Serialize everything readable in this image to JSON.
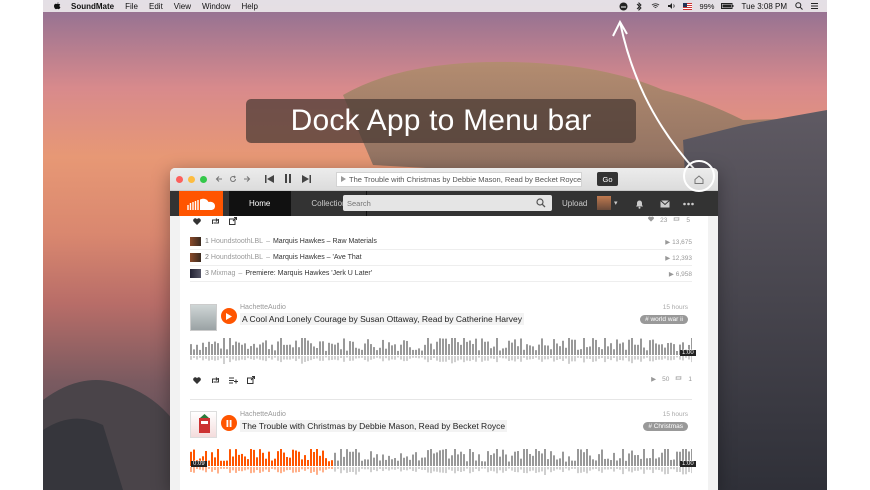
{
  "menubar": {
    "app_name": "SoundMate",
    "menus": [
      "File",
      "Edit",
      "View",
      "Window",
      "Help"
    ],
    "battery": "99%",
    "clock": "Tue 3:08 PM"
  },
  "banner": {
    "text": "Dock App to Menu bar"
  },
  "window": {
    "now_playing": "The Trouble with Christmas by Debbie Mason, Read by Becket Royce by...",
    "go_label": "Go"
  },
  "header": {
    "tabs": [
      "Home",
      "Collection"
    ],
    "search_placeholder": "Search",
    "upload_label": "Upload"
  },
  "top_stats": {
    "likes": "23",
    "reposts": "5"
  },
  "tracklist": [
    {
      "index": "1",
      "artist": "HoundstoothLBL",
      "title": "Marquis Hawkes – Raw Materials",
      "plays": "13,675"
    },
    {
      "index": "2",
      "artist": "HoundstoothLBL",
      "title": "Marquis Hawkes – 'Ave That",
      "plays": "12,393"
    },
    {
      "index": "3",
      "artist": "Mixmag",
      "title": "Premiere: Marquis Hawkes 'Jerk U Later'",
      "plays": "6,958"
    }
  ],
  "posts": [
    {
      "uploader": "HachetteAudio",
      "title": "A Cool And Lonely Courage by Susan Ottaway, Read by Catherine Harvey",
      "time_ago": "15 hours",
      "tag": "# world war ii",
      "duration": "1:00",
      "plays": "50",
      "reposts": "1",
      "progress": 0
    },
    {
      "uploader": "HachetteAudio",
      "title": "The Trouble with Christmas by Debbie Mason, Read by Becket Royce",
      "time_ago": "15 hours",
      "tag": "# Christmas",
      "elapsed": "0:09",
      "duration": "1:00",
      "progress": 0.28
    }
  ],
  "colors": {
    "accent": "#ff5500",
    "header_bg": "#333333",
    "wave_gray": "#999999"
  }
}
